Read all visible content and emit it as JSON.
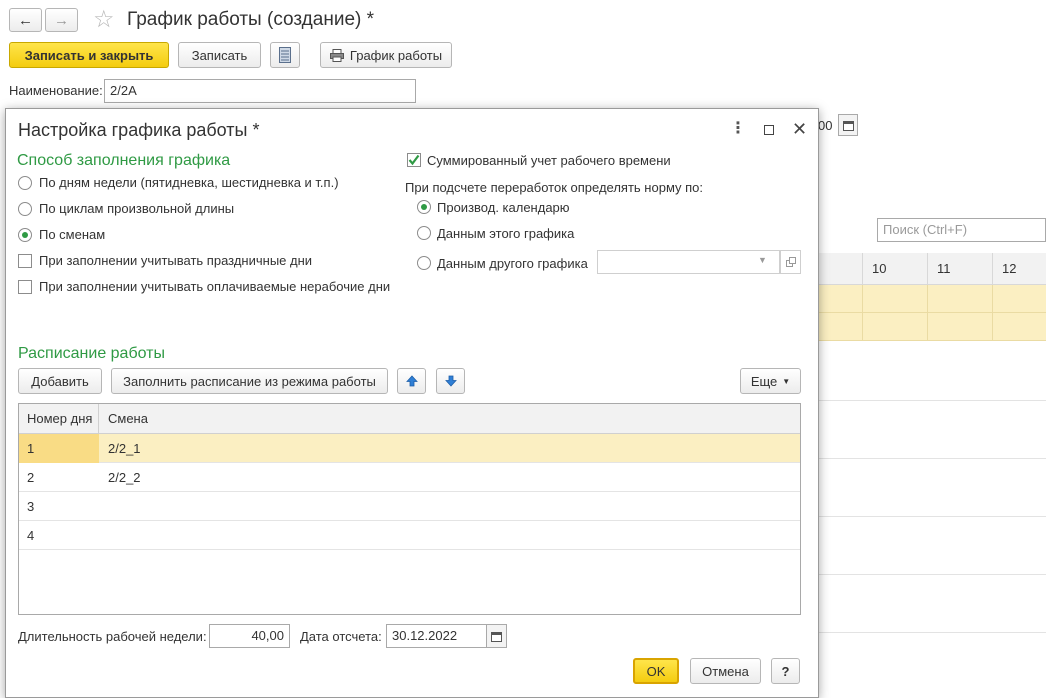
{
  "window": {
    "title": "График работы (создание) *",
    "nav_back": "←",
    "nav_forward": "→",
    "star": "☆"
  },
  "toolbar": {
    "save_close": "Записать и закрыть",
    "save": "Записать",
    "schedule": "График работы"
  },
  "form": {
    "name_label": "Наименование:",
    "name_value": "2/2А",
    "partial_value": "00",
    "search_placeholder": "Поиск (Ctrl+F)",
    "grid_columns": [
      "10",
      "11",
      "12"
    ]
  },
  "dialog": {
    "title": "Настройка графика работы *",
    "fill_section": "Способ заполнения графика",
    "fill_options": [
      {
        "label": "По дням недели (пятидневка, шестидневка и т.п.)",
        "selected": false
      },
      {
        "label": "По циклам произвольной длины",
        "selected": false
      },
      {
        "label": "По сменам",
        "selected": true
      }
    ],
    "checkboxes": [
      {
        "label": "При заполнении учитывать праздничные дни",
        "checked": false
      },
      {
        "label": "При заполнении учитывать оплачиваемые нерабочие дни",
        "checked": false
      }
    ],
    "summary_check": {
      "label": "Суммированный учет рабочего времени",
      "checked": true
    },
    "norm_label": "При подсчете переработок определять норму по:",
    "norm_options": [
      {
        "label": "Производ. календарю",
        "selected": true
      },
      {
        "label": "Данным этого графика",
        "selected": false
      },
      {
        "label": "Данным другого графика",
        "selected": false
      }
    ],
    "other_schedule_value": "",
    "schedule_section": "Расписание работы",
    "add_button": "Добавить",
    "fill_button": "Заполнить расписание из режима работы",
    "more_button": "Еще",
    "table": {
      "headers": [
        "Номер дня",
        "Смена"
      ],
      "rows": [
        {
          "day": "1",
          "shift": "2/2_1"
        },
        {
          "day": "2",
          "shift": "2/2_2"
        },
        {
          "day": "3",
          "shift": ""
        },
        {
          "day": "4",
          "shift": ""
        }
      ]
    },
    "week_length_label": "Длительность рабочей недели:",
    "week_length_value": "40,00",
    "date_label": "Дата отсчета:",
    "date_value": "30.12.2022",
    "ok": "OK",
    "cancel": "Отмена",
    "help": "?"
  },
  "colors": {
    "accent_green": "#2f9a44",
    "highlight_yellow": "#fbefc2",
    "primary_button": "#f4cc10"
  }
}
